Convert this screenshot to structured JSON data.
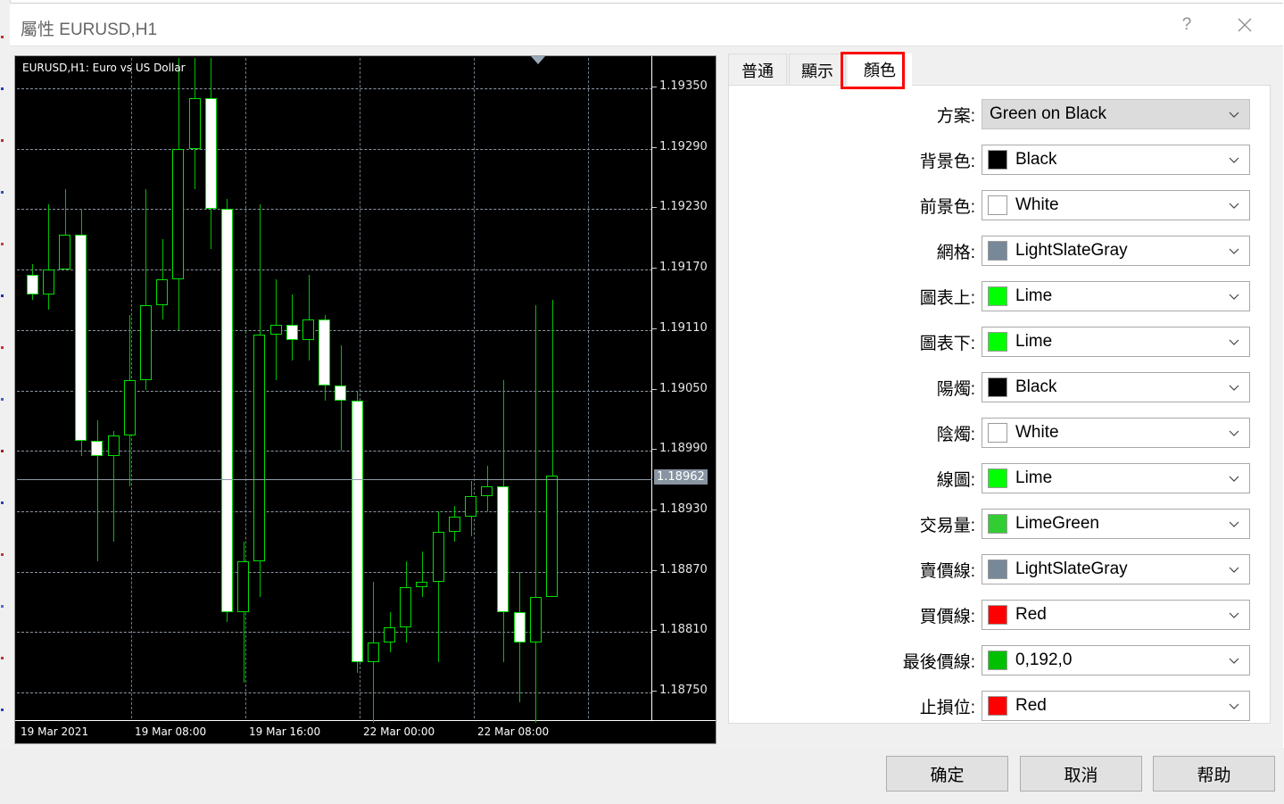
{
  "window": {
    "title": "屬性 EURUSD,H1",
    "help_icon": "question-mark-icon",
    "close_icon": "close-icon"
  },
  "chart": {
    "title": "EURUSD,H1:  Euro vs US Dollar",
    "symbol": "EURUSD",
    "timeframe": "H1",
    "current_price": "1.18962",
    "background_color": "#000000",
    "grid_color": "#778899",
    "candle_outline_color": "#00FF00",
    "bull_fill_color": "#000000",
    "bear_fill_color": "#FFFFFF",
    "price_labels": [
      "1.19350",
      "1.19290",
      "1.19230",
      "1.19170",
      "1.19110",
      "1.19050",
      "1.18990",
      "1.18930",
      "1.18870",
      "1.18810",
      "1.18750"
    ],
    "time_labels": [
      "19 Mar 2021",
      "19 Mar 08:00",
      "19 Mar 16:00",
      "22 Mar 00:00",
      "22 Mar 08:00"
    ]
  },
  "chart_data": {
    "type": "candlestick",
    "title": "EURUSD,H1:  Euro vs US Dollar",
    "xlabel": "",
    "ylabel": "",
    "ylim": [
      1.1872,
      1.1938
    ],
    "price_ticks": [
      1.1935,
      1.1929,
      1.1923,
      1.1917,
      1.1911,
      1.1905,
      1.1899,
      1.1893,
      1.1887,
      1.1881,
      1.1875
    ],
    "time_ticks": [
      "19 Mar 2021",
      "19 Mar 08:00",
      "19 Mar 16:00",
      "22 Mar 00:00",
      "22 Mar 08:00"
    ],
    "bid_line": 1.18962,
    "grid": true,
    "candles": [
      {
        "o": 1.19165,
        "h": 1.19175,
        "l": 1.1914,
        "c": 1.19145
      },
      {
        "o": 1.19145,
        "h": 1.19235,
        "l": 1.1913,
        "c": 1.1917
      },
      {
        "o": 1.1917,
        "h": 1.1925,
        "l": 1.19185,
        "c": 1.19205
      },
      {
        "o": 1.19205,
        "h": 1.1923,
        "l": 1.18985,
        "c": 1.19
      },
      {
        "o": 1.19,
        "h": 1.1902,
        "l": 1.1888,
        "c": 1.18985
      },
      {
        "o": 1.18985,
        "h": 1.1901,
        "l": 1.189,
        "c": 1.19005
      },
      {
        "o": 1.19005,
        "h": 1.19125,
        "l": 1.18955,
        "c": 1.1906
      },
      {
        "o": 1.1906,
        "h": 1.1925,
        "l": 1.1905,
        "c": 1.19135
      },
      {
        "o": 1.19135,
        "h": 1.192,
        "l": 1.1912,
        "c": 1.1916
      },
      {
        "o": 1.1916,
        "h": 1.194,
        "l": 1.1911,
        "c": 1.1929
      },
      {
        "o": 1.1929,
        "h": 1.1942,
        "l": 1.1925,
        "c": 1.1934
      },
      {
        "o": 1.1934,
        "h": 1.1938,
        "l": 1.1919,
        "c": 1.1923
      },
      {
        "o": 1.1923,
        "h": 1.1924,
        "l": 1.1882,
        "c": 1.1883
      },
      {
        "o": 1.1883,
        "h": 1.189,
        "l": 1.1876,
        "c": 1.1888
      },
      {
        "o": 1.1888,
        "h": 1.19235,
        "l": 1.18845,
        "c": 1.19105
      },
      {
        "o": 1.19105,
        "h": 1.1916,
        "l": 1.1906,
        "c": 1.19115
      },
      {
        "o": 1.19115,
        "h": 1.19145,
        "l": 1.1908,
        "c": 1.191
      },
      {
        "o": 1.191,
        "h": 1.19165,
        "l": 1.1908,
        "c": 1.1912
      },
      {
        "o": 1.1912,
        "h": 1.19125,
        "l": 1.1904,
        "c": 1.19055
      },
      {
        "o": 1.19055,
        "h": 1.19095,
        "l": 1.1899,
        "c": 1.1904
      },
      {
        "o": 1.1904,
        "h": 1.1905,
        "l": 1.1877,
        "c": 1.1878
      },
      {
        "o": 1.1878,
        "h": 1.1886,
        "l": 1.1872,
        "c": 1.188
      },
      {
        "o": 1.188,
        "h": 1.1883,
        "l": 1.1879,
        "c": 1.18815
      },
      {
        "o": 1.18815,
        "h": 1.1888,
        "l": 1.188,
        "c": 1.18855
      },
      {
        "o": 1.18855,
        "h": 1.1889,
        "l": 1.18845,
        "c": 1.1886
      },
      {
        "o": 1.1886,
        "h": 1.1893,
        "l": 1.1878,
        "c": 1.1891
      },
      {
        "o": 1.1891,
        "h": 1.18935,
        "l": 1.189,
        "c": 1.18925
      },
      {
        "o": 1.18925,
        "h": 1.1896,
        "l": 1.18905,
        "c": 1.18945
      },
      {
        "o": 1.18945,
        "h": 1.18975,
        "l": 1.1893,
        "c": 1.18955
      },
      {
        "o": 1.18955,
        "h": 1.1906,
        "l": 1.1878,
        "c": 1.1883
      },
      {
        "o": 1.1883,
        "h": 1.1887,
        "l": 1.1874,
        "c": 1.188
      },
      {
        "o": 1.188,
        "h": 1.19135,
        "l": 1.1872,
        "c": 1.18845
      },
      {
        "o": 1.18845,
        "h": 1.1914,
        "l": 1.1895,
        "c": 1.18965
      }
    ]
  },
  "tabs": [
    {
      "id": "general",
      "label": "普通",
      "active": false
    },
    {
      "id": "display",
      "label": "顯示",
      "active": false
    },
    {
      "id": "colors",
      "label": "顏色",
      "active": true
    }
  ],
  "colors_panel": {
    "rows": [
      {
        "label": "方案:",
        "value": "Green on Black",
        "swatch": null,
        "is_scheme": true
      },
      {
        "label": "背景色:",
        "value": "Black",
        "swatch": "#000000",
        "is_scheme": false
      },
      {
        "label": "前景色:",
        "value": "White",
        "swatch": "#FFFFFF",
        "is_scheme": false
      },
      {
        "label": "網格:",
        "value": "LightSlateGray",
        "swatch": "#778899",
        "is_scheme": false
      },
      {
        "label": "圖表上:",
        "value": "Lime",
        "swatch": "#00FF00",
        "is_scheme": false
      },
      {
        "label": "圖表下:",
        "value": "Lime",
        "swatch": "#00FF00",
        "is_scheme": false
      },
      {
        "label": "陽燭:",
        "value": "Black",
        "swatch": "#000000",
        "is_scheme": false
      },
      {
        "label": "陰燭:",
        "value": "White",
        "swatch": "#FFFFFF",
        "is_scheme": false
      },
      {
        "label": "線圖:",
        "value": "Lime",
        "swatch": "#00FF00",
        "is_scheme": false
      },
      {
        "label": "交易量:",
        "value": "LimeGreen",
        "swatch": "#32CD32",
        "is_scheme": false
      },
      {
        "label": "賣價線:",
        "value": "LightSlateGray",
        "swatch": "#778899",
        "is_scheme": false
      },
      {
        "label": "買價線:",
        "value": "Red",
        "swatch": "#FF0000",
        "is_scheme": false
      },
      {
        "label": "最後價線:",
        "value": "0,192,0",
        "swatch": "#00C000",
        "is_scheme": false
      },
      {
        "label": "止損位:",
        "value": "Red",
        "swatch": "#FF0000",
        "is_scheme": false
      }
    ]
  },
  "footer": {
    "ok_label": "确定",
    "cancel_label": "取消",
    "help_label": "帮助"
  }
}
